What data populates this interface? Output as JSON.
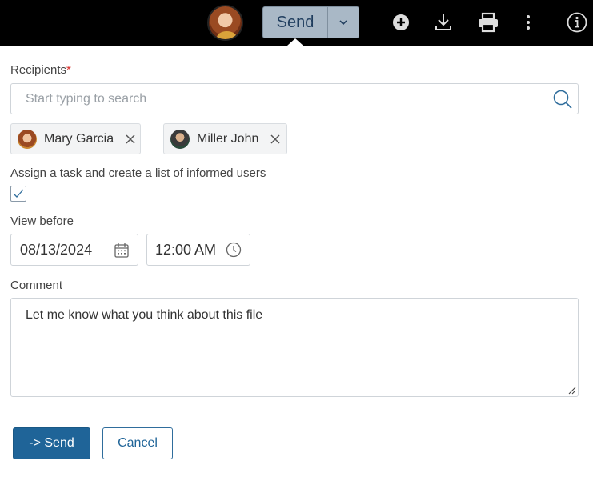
{
  "toolbar": {
    "send_label": "Send",
    "icons": [
      "add-circle-icon",
      "download-icon",
      "print-icon",
      "more-vertical-icon",
      "info-icon"
    ]
  },
  "recipients": {
    "label": "Recipients",
    "required_mark": "*",
    "search_placeholder": "Start typing to search",
    "chips": [
      {
        "name": "Mary Garcia"
      },
      {
        "name": "Miller John"
      }
    ]
  },
  "assign": {
    "label": "Assign a task and create a list of informed users",
    "checked": true
  },
  "view_before": {
    "label": "View before",
    "date": "08/13/2024",
    "time": "12:00 AM"
  },
  "comment": {
    "label": "Comment",
    "value": "Let me know what you think about this file"
  },
  "actions": {
    "send_label": "-> Send",
    "cancel_label": "Cancel"
  },
  "colors": {
    "topbar": "#000000",
    "send_button_bg": "#a9b8c6",
    "primary": "#1f6498",
    "required": "#d9302c"
  }
}
